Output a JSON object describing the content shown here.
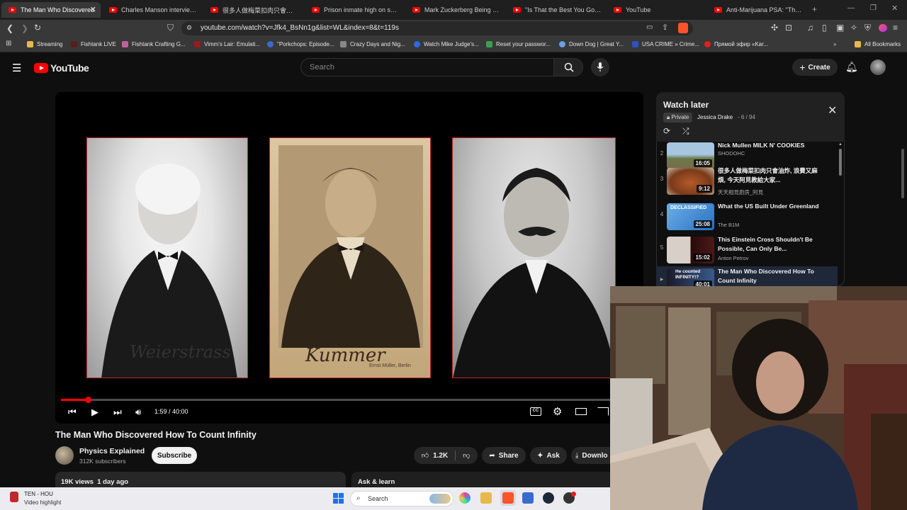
{
  "browser": {
    "tabs": [
      {
        "title": "The Man Who Discovered",
        "active": true
      },
      {
        "title": "Charles Manson interview: He"
      },
      {
        "title": "很多人做梅菜扣肉只會油炸,"
      },
      {
        "title": "Prison inmate high on spice he"
      },
      {
        "title": "Mark Zuckerberg Being a Robo"
      },
      {
        "title": "\"Is That the Best You Got?\" - M"
      },
      {
        "title": "YouTube"
      },
      {
        "title": "Anti-Marijuana PSA: \"The Deat"
      }
    ],
    "new_tab": "+",
    "url": "youtube.com/watch?v=Jfk4_BsNn1g&list=WL&index=8&t=119s",
    "bookmarks": [
      {
        "label": "Streaming",
        "color": "#e8b84a"
      },
      {
        "label": "Fishtank LIVE",
        "color": "#5a1c1c"
      },
      {
        "label": "Fishtank Crafting G...",
        "color": "#c45ca0"
      },
      {
        "label": "Vimm's Lair: Emulati...",
        "color": "#9a1a1a"
      },
      {
        "label": "\"Porkchops: Episode...",
        "color": "#3a6ad0"
      },
      {
        "label": "Crazy Days and Nig...",
        "color": "#888888"
      },
      {
        "label": "Watch Mike Judge's...",
        "color": "#2a6ae8"
      },
      {
        "label": "Reset your passwor...",
        "color": "#3aa050"
      },
      {
        "label": "Down Dog | Great Y...",
        "color": "#6aa0e0"
      },
      {
        "label": "USA CRIME » Crime...",
        "color": "#3050c0"
      },
      {
        "label": "Прямой эфир «Kar...",
        "color": "#e02020"
      }
    ],
    "all_bookmarks": "All Bookmarks"
  },
  "header": {
    "logo_text": "YouTube",
    "search_placeholder": "Search",
    "create_label": "Create"
  },
  "player": {
    "time_current": "1:59",
    "time_total": "40:00",
    "time_display": "1:59 / 40:00",
    "progress_fraction": 0.0496,
    "portraits": [
      {
        "signature": "Weierstrass"
      },
      {
        "signature": "Kummer",
        "studio": "Ernst Müller, Berlin"
      },
      {
        "signature": ""
      }
    ]
  },
  "video": {
    "title": "The Man Who Discovered How To Count Infinity",
    "channel": "Physics Explained",
    "subscribers": "312K subscribers",
    "subscribe_label": "Subscribe",
    "likes": "1.2K",
    "share_label": "Share",
    "ask_label": "Ask",
    "download_label": "Downlo",
    "views_line": "19K views  1 day ago",
    "ask_learn": "Ask & learn"
  },
  "playlist": {
    "title": "Watch later",
    "privacy": "Private",
    "owner": "Jessica Drake",
    "position": "- 6 / 94",
    "items": [
      {
        "num": "2",
        "title": "Nick Mullen MILK N' COOKIES",
        "channel": "SHODOHC",
        "duration": "16:05"
      },
      {
        "num": "3",
        "title": "很多人做梅菜扣肉只會油炸, 浪費又麻煩, 今天阿見教給大家...",
        "channel": "天天相見廚房_阿見",
        "duration": "9:12"
      },
      {
        "num": "4",
        "title": "What the US Built Under Greenland",
        "channel": "The B1M",
        "duration": "25:08",
        "thumb_text": "DECLASSIFIED"
      },
      {
        "num": "5",
        "title": "This Einstein Cross Shouldn't Be Possible, Can Only Be...",
        "channel": "Anton Petrov",
        "duration": "15:02"
      },
      {
        "num": "▶",
        "title": "The Man Who Discovered How To Count Infinity",
        "channel": "",
        "duration": "40:01",
        "thumb_text": "He counted INFINITY!?",
        "current": true
      }
    ]
  },
  "taskbar": {
    "notif_title": "TEN - HOU",
    "notif_sub": "Video highlight",
    "search_label": "Search"
  },
  "colors": {
    "accent": "#ff0000",
    "bg": "#0f0f0f",
    "panel": "#212121"
  }
}
